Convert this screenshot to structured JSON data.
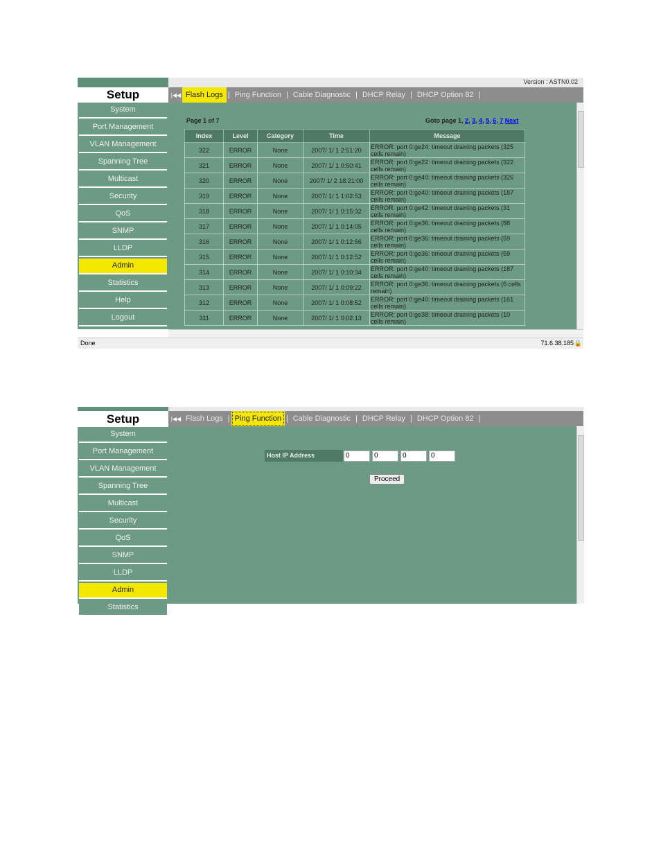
{
  "version": "Version : ASTN0.02",
  "setup": "Setup",
  "tabs": [
    "Flash Logs",
    "Ping Function",
    "Cable Diagnostic",
    "DHCP Relay",
    "DHCP Option 82"
  ],
  "sidebar1": [
    "System",
    "Port Management",
    "VLAN Management",
    "Spanning Tree",
    "Multicast",
    "Security",
    "QoS",
    "SNMP",
    "LLDP",
    "Admin",
    "Statistics",
    "Help",
    "Logout"
  ],
  "sidebar2": [
    "System",
    "Port Management",
    "VLAN Management",
    "Spanning Tree",
    "Multicast",
    "Security",
    "QoS",
    "SNMP",
    "LLDP",
    "Admin",
    "Statistics"
  ],
  "active_sidebar": "Admin",
  "logs": {
    "page_info": "Page 1 of 7",
    "goto_label": "Goto page",
    "current_page": "1",
    "pages": [
      "2",
      "3",
      "4",
      "5",
      "6",
      "7"
    ],
    "next": "Next",
    "columns": [
      "Index",
      "Level",
      "Category",
      "Time",
      "Message"
    ],
    "rows": [
      [
        "322",
        "ERROR",
        "None",
        "2007/ 1/ 1 2:51:20",
        "ERROR: port 0:ge24: timeout draining packets (325 cells remain)"
      ],
      [
        "321",
        "ERROR",
        "None",
        "2007/ 1/ 1 0:50:41",
        "ERROR: port 0:ge22: timeout draining packets (322 cells remain)"
      ],
      [
        "320",
        "ERROR",
        "None",
        "2007/ 1/ 2 18:21:00",
        "ERROR: port 0:ge40: timeout draining packets (326 cells remain)"
      ],
      [
        "319",
        "ERROR",
        "None",
        "2007/ 1/ 1 1:02:53",
        "ERROR: port 0:ge40: timeout draining packets (187 cells remain)"
      ],
      [
        "318",
        "ERROR",
        "None",
        "2007/ 1/ 1 0:15:32",
        "ERROR: port 0:ge42: timeout draining packets (31 cells remain)"
      ],
      [
        "317",
        "ERROR",
        "None",
        "2007/ 1/ 1 0:14:05",
        "ERROR: port 0:ge36: timeout draining packets (88 cells remain)"
      ],
      [
        "316",
        "ERROR",
        "None",
        "2007/ 1/ 1 0:12:56",
        "ERROR: port 0:ge36: timeout draining packets (59 cells remain)"
      ],
      [
        "315",
        "ERROR",
        "None",
        "2007/ 1/ 1 0:12:52",
        "ERROR: port 0:ge36: timeout draining packets (59 cells remain)"
      ],
      [
        "314",
        "ERROR",
        "None",
        "2007/ 1/ 1 0:10:34",
        "ERROR: port 0:ge40: timeout draining packets (187 cells remain)"
      ],
      [
        "313",
        "ERROR",
        "None",
        "2007/ 1/ 1 0:09:22",
        "ERROR: port 0:ge36: timeout draining packets (6 cells remain)"
      ],
      [
        "312",
        "ERROR",
        "None",
        "2007/ 1/ 1 0:08:52",
        "ERROR: port 0:ge40: timeout draining packets (161 cells remain)"
      ],
      [
        "311",
        "ERROR",
        "None",
        "2007/ 1/ 1 0:02:13",
        "ERROR: port 0:ge38: timeout draining packets (10 cells remain)"
      ]
    ]
  },
  "status": {
    "text": "Done",
    "ip": "71.6.38.185"
  },
  "ping": {
    "label": "Host IP Address",
    "octets": [
      "0",
      "0",
      "0",
      "0"
    ],
    "button": "Proceed"
  }
}
